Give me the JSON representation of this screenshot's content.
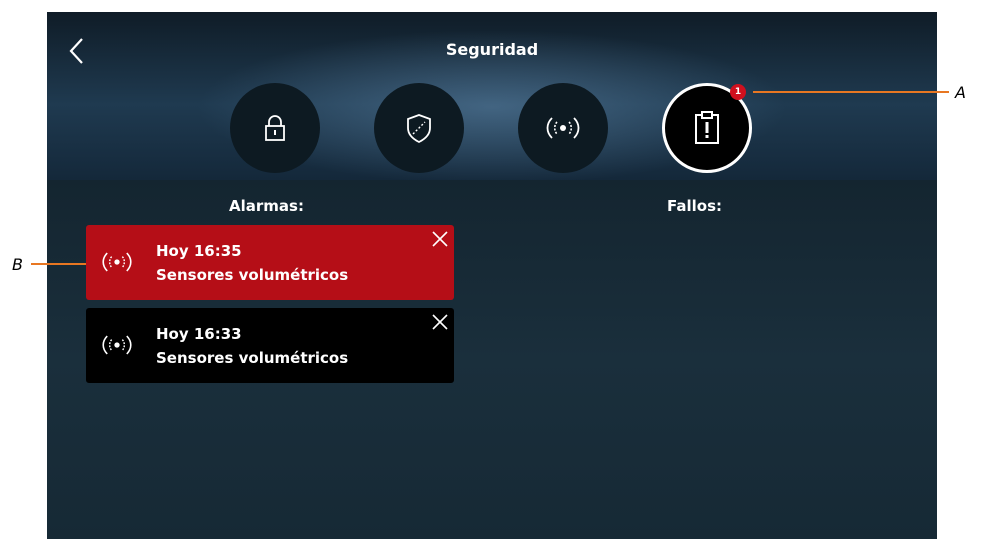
{
  "header": {
    "title": "Seguridad"
  },
  "tabs": [
    {
      "icon": "lock-icon"
    },
    {
      "icon": "shield-icon"
    },
    {
      "icon": "sensor-icon"
    },
    {
      "icon": "report-alert-icon",
      "active": true,
      "badge": "1"
    }
  ],
  "columns": {
    "alarms_title": "Alarmas:",
    "faults_title": "Fallos:"
  },
  "alarms": [
    {
      "time": "Hoy 16:35",
      "name": "Sensores volumétricos",
      "icon": "sensor-icon",
      "state": "active"
    },
    {
      "time": "Hoy 16:33",
      "name": "Sensores volumétricos",
      "icon": "sensor-icon",
      "state": "inactive"
    }
  ],
  "callouts": {
    "a": "A",
    "b": "B"
  },
  "colors": {
    "alarm_active": "#b50e17",
    "badge": "#d0101e",
    "callout_line": "#e87722"
  }
}
